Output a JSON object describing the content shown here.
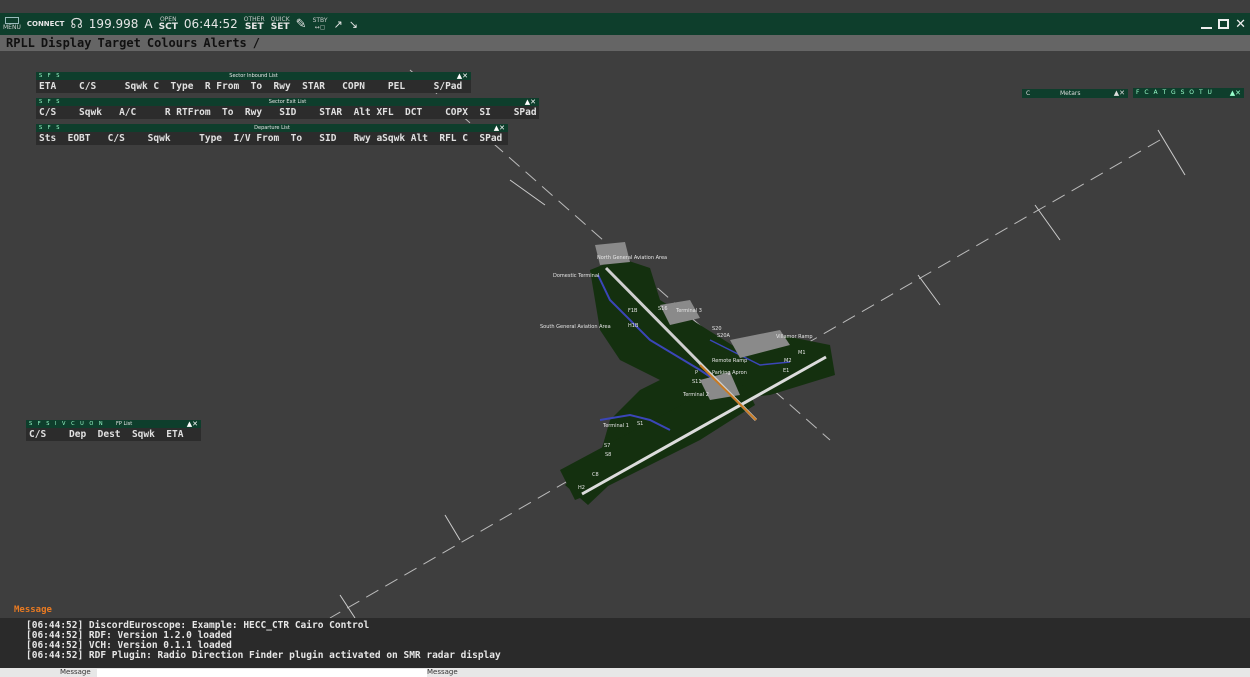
{
  "toolbar": {
    "menu_label": "MENU",
    "connect_label": "CONNECT",
    "frequency": "199.998",
    "atis_letter": "A",
    "open_label": "OPEN",
    "sct_label": "SCT",
    "clock": "06:44:52",
    "other_label": "OTHER",
    "set_label": "SET",
    "quick_label": "QUICK",
    "set2_label": "SET",
    "stby_label": "STBY"
  },
  "menubar": {
    "items": [
      "RPLL",
      "Display",
      "Target",
      "Colours",
      "Alerts",
      "/"
    ]
  },
  "lists": {
    "inbound": {
      "flags": "S F S",
      "title": "Sector Inbound List",
      "columns": "ETA    C/S     Sqwk C  Type  R From  To  Rwy  STAR   COPN    PEL     S/Pad"
    },
    "exit": {
      "flags": "S F S",
      "title": "Sector Exit List",
      "columns": "C/S    Sqwk   A/C     R RTFrom  To  Rwy   SID    STAR  Alt XFL  DCT    COPX  SI    SPad"
    },
    "departure": {
      "flags": "S F S",
      "title": "Departure List",
      "columns": "Sts  EOBT   C/S    Sqwk     Type  I/V From  To   SID   Rwy aSqwk Alt  RFL C  SPad"
    },
    "fp": {
      "flags": "S F S I V C U O N",
      "title": "FP List",
      "columns": "C/S    Dep  Dest  Sqwk  ETA"
    }
  },
  "metars": {
    "flag": "C",
    "title": "Metars"
  },
  "right_flags": "F C A T G S O T U",
  "map_labels": {
    "north_ga": "North General Aviation Area",
    "domestic": "Domestic Terminal",
    "south_ga": "South General Aviation Area",
    "terminal3": "Terminal 3",
    "terminal2": "Terminal 2",
    "terminal1": "Terminal 1",
    "villamor": "Villamor Ramp",
    "remote": "Remote Ramp",
    "parking": "Parking Apron",
    "s20": "S20",
    "s20a": "S20A",
    "h2": "H2",
    "c8": "C8",
    "m1": "M1",
    "m2": "M2",
    "e1": "E1",
    "f1b": "F1B",
    "h1b": "H1B",
    "s7": "S7",
    "s8": "S8",
    "s1": "S1",
    "p": "P",
    "s11": "S11",
    "s16": "S16"
  },
  "messages": {
    "title": "Message",
    "lines": [
      "[06:44:52] DiscordEuroscope: Example: HECC_CTR Cairo Control",
      "[06:44:52] RDF: Version 1.2.0 loaded",
      "[06:44:52] VCH: Version 0.1.1 loaded",
      "[06:44:52] RDF Plugin: Radio Direction Finder plugin activated on SMR radar display"
    ],
    "input_label_left": "Message",
    "input_label_right": "Message",
    "input_value": ""
  },
  "colors": {
    "background": "#3e3e3e",
    "toolbar": "#0e3e2c",
    "airport_ground": "#14300f",
    "message_title": "#e87a22",
    "taxi_line": "#3b46b8"
  }
}
